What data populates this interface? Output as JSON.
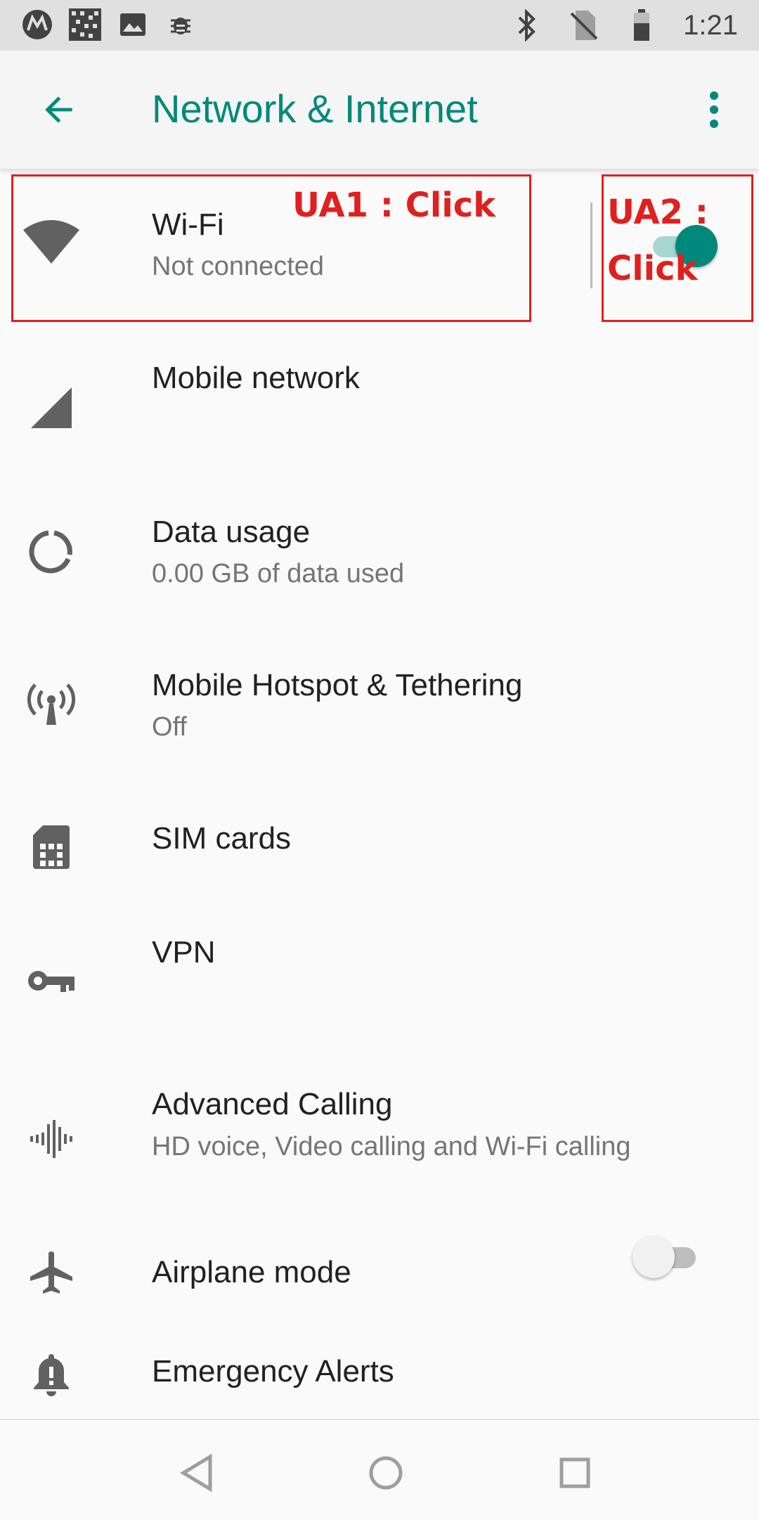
{
  "status_bar": {
    "time": "1:21",
    "left_icons": [
      "motorola-icon",
      "qr-icon",
      "image-icon",
      "bug-icon"
    ],
    "right_icons": [
      "bluetooth-icon",
      "no-sim-icon",
      "battery-icon"
    ]
  },
  "app_bar": {
    "title": "Network & Internet",
    "accent_color": "#00897b"
  },
  "items": [
    {
      "title": "Wi-Fi",
      "subtitle": "Not connected",
      "icon": "wifi-icon",
      "toggle": true
    },
    {
      "title": "Mobile network",
      "subtitle": "",
      "icon": "signal-icon"
    },
    {
      "title": "Data usage",
      "subtitle": "0.00 GB of data used",
      "icon": "data-usage-icon"
    },
    {
      "title": "Mobile Hotspot & Tethering",
      "subtitle": "Off",
      "icon": "hotspot-icon"
    },
    {
      "title": "SIM cards",
      "subtitle": "",
      "icon": "sim-card-icon"
    },
    {
      "title": "VPN",
      "subtitle": "",
      "icon": "vpn-key-icon"
    },
    {
      "title": "Advanced Calling",
      "subtitle": "HD voice, Video calling and Wi-Fi calling",
      "icon": "voice-wave-icon"
    },
    {
      "title": "Airplane mode",
      "subtitle": "",
      "icon": "airplane-icon",
      "toggle": false
    },
    {
      "title": "Emergency Alerts",
      "subtitle": "",
      "icon": "alert-bell-icon"
    }
  ],
  "annotations": {
    "ua1": "UA1 : Click",
    "ua2_line1": "UA2 :",
    "ua2_line2": "Click",
    "color": "#e0201e"
  },
  "nav_bar": {
    "icons": [
      "back-nav-icon",
      "home-nav-icon",
      "recents-nav-icon"
    ]
  }
}
